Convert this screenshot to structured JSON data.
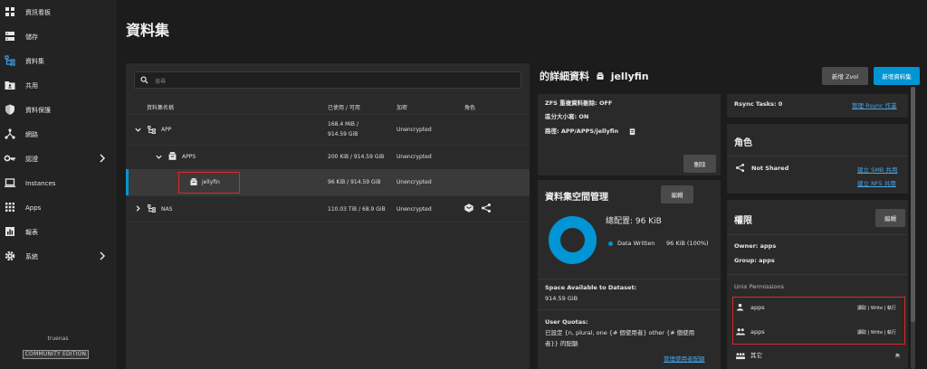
{
  "sidebar": {
    "items": [
      {
        "label": "資訊看板",
        "icon": "dashboard-icon"
      },
      {
        "label": "儲存",
        "icon": "storage-icon"
      },
      {
        "label": "資料集",
        "icon": "datasets-icon"
      },
      {
        "label": "共用",
        "icon": "shares-icon"
      },
      {
        "label": "資料保護",
        "icon": "shield-icon"
      },
      {
        "label": "網路",
        "icon": "network-icon"
      },
      {
        "label": "認證",
        "icon": "key-icon"
      },
      {
        "label": "Instances",
        "icon": "laptop-icon"
      },
      {
        "label": "Apps",
        "icon": "apps-grid-icon"
      },
      {
        "label": "報表",
        "icon": "reports-icon"
      },
      {
        "label": "系統",
        "icon": "gear-icon"
      }
    ],
    "brand": "truenas",
    "edition": "COMMUNITY EDITION"
  },
  "page": {
    "title": "資料集"
  },
  "search": {
    "placeholder": "搜尋"
  },
  "table": {
    "headers": [
      "資料集名稱",
      "已使用 / 可用",
      "加密",
      "角色"
    ],
    "rows": [
      {
        "name": "APP",
        "used_line1": "168.4 MiB /",
        "used_line2": "914.59 GiB",
        "encryption": "Unencrypted"
      },
      {
        "name": "APPS",
        "used": "200 KiB / 914.59 GiB",
        "encryption": "Unencrypted"
      },
      {
        "name": "jellyfin",
        "used": "96 KiB / 914.59 GiB",
        "encryption": "Unencrypted"
      },
      {
        "name": "NAS",
        "used": "110.03 TiB / 68.9 GiB",
        "encryption": "Unencrypted"
      }
    ]
  },
  "details": {
    "title_prefix": "的詳細資料",
    "dataset_name": "jellyfin",
    "add_zvol": "新增 Zvol",
    "add_dataset": "新增資料集",
    "zfs_dedup": "ZFS 重複資料刪除: OFF",
    "case_sensitive": "區分大小寫: ON",
    "path": "路徑: APP/APPS/jellyfin",
    "delete_label": "刪除"
  },
  "space": {
    "title": "資料集空間管理",
    "edit_label": "編輯",
    "total": "總配置:  96 KiB",
    "legend_label": "Data Written",
    "legend_value": "96 KiB (100%)",
    "avail_label": "Space Available to Dataset:",
    "avail_value": "914.59 GiB",
    "quota_label": "User Quotas:",
    "quota_line1": "已設定 {n, plural, one {# 個使用者} other {# 個使用",
    "quota_line2": "者}} 的配額",
    "manage_quota": "管理使用者配額",
    "donut_color": "#0095d5"
  },
  "rsync": {
    "label": "Rsync Tasks: 0",
    "link": "管理 Rsync 作業"
  },
  "roles": {
    "title": "角色",
    "not_shared": "Not Shared",
    "smb_link": "建立 SMB 共用",
    "nfs_link": "建立 NFS 共用"
  },
  "perms": {
    "title": "權限",
    "edit_label": "編輯",
    "owner": "Owner: apps",
    "group": "Group: apps",
    "unix_label": "Unix Permissions",
    "user_name": "apps",
    "user_perm": "讀取 | Write | 執行",
    "group_name": "apps",
    "group_perm": "讀取 | Write | 執行",
    "other_name": "其它",
    "other_perm": "無"
  }
}
